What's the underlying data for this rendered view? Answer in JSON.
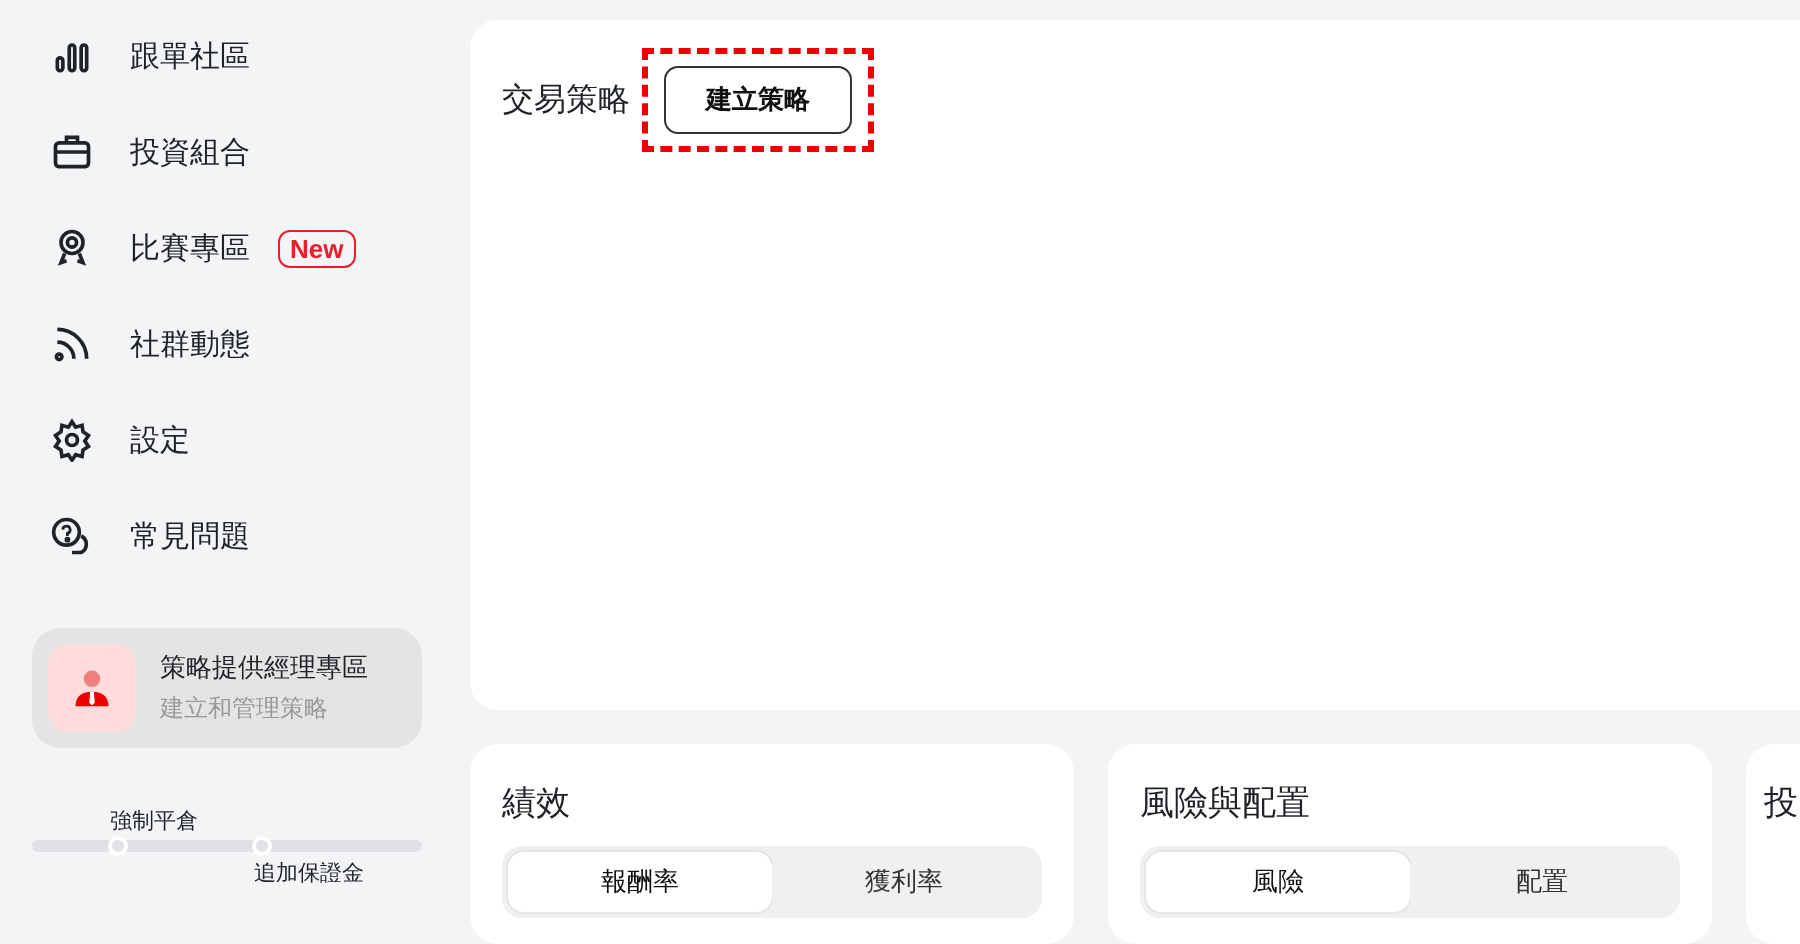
{
  "sidebar": {
    "items": [
      {
        "label": "跟單社區"
      },
      {
        "label": "投資組合"
      },
      {
        "label": "比賽專區",
        "badge": "New"
      },
      {
        "label": "社群動態"
      },
      {
        "label": "設定"
      },
      {
        "label": "常見問題"
      }
    ],
    "manager_card": {
      "title": "策略提供經理專區",
      "subtitle": "建立和管理策略"
    },
    "risk_meter": {
      "markers": [
        {
          "label": "強制平倉",
          "level": 0.22
        },
        {
          "label": "追加保證金",
          "level": 0.59
        }
      ]
    }
  },
  "strategy_panel": {
    "title": "交易策略",
    "button": "建立策略"
  },
  "cards": [
    {
      "title": "績效",
      "tabs": [
        {
          "label": "報酬率",
          "selected": true
        },
        {
          "label": "獲利率",
          "selected": false
        }
      ]
    },
    {
      "title": "風險與配置",
      "tabs": [
        {
          "label": "風險",
          "selected": true
        },
        {
          "label": "配置",
          "selected": false
        }
      ]
    },
    {
      "title": "投"
    }
  ]
}
